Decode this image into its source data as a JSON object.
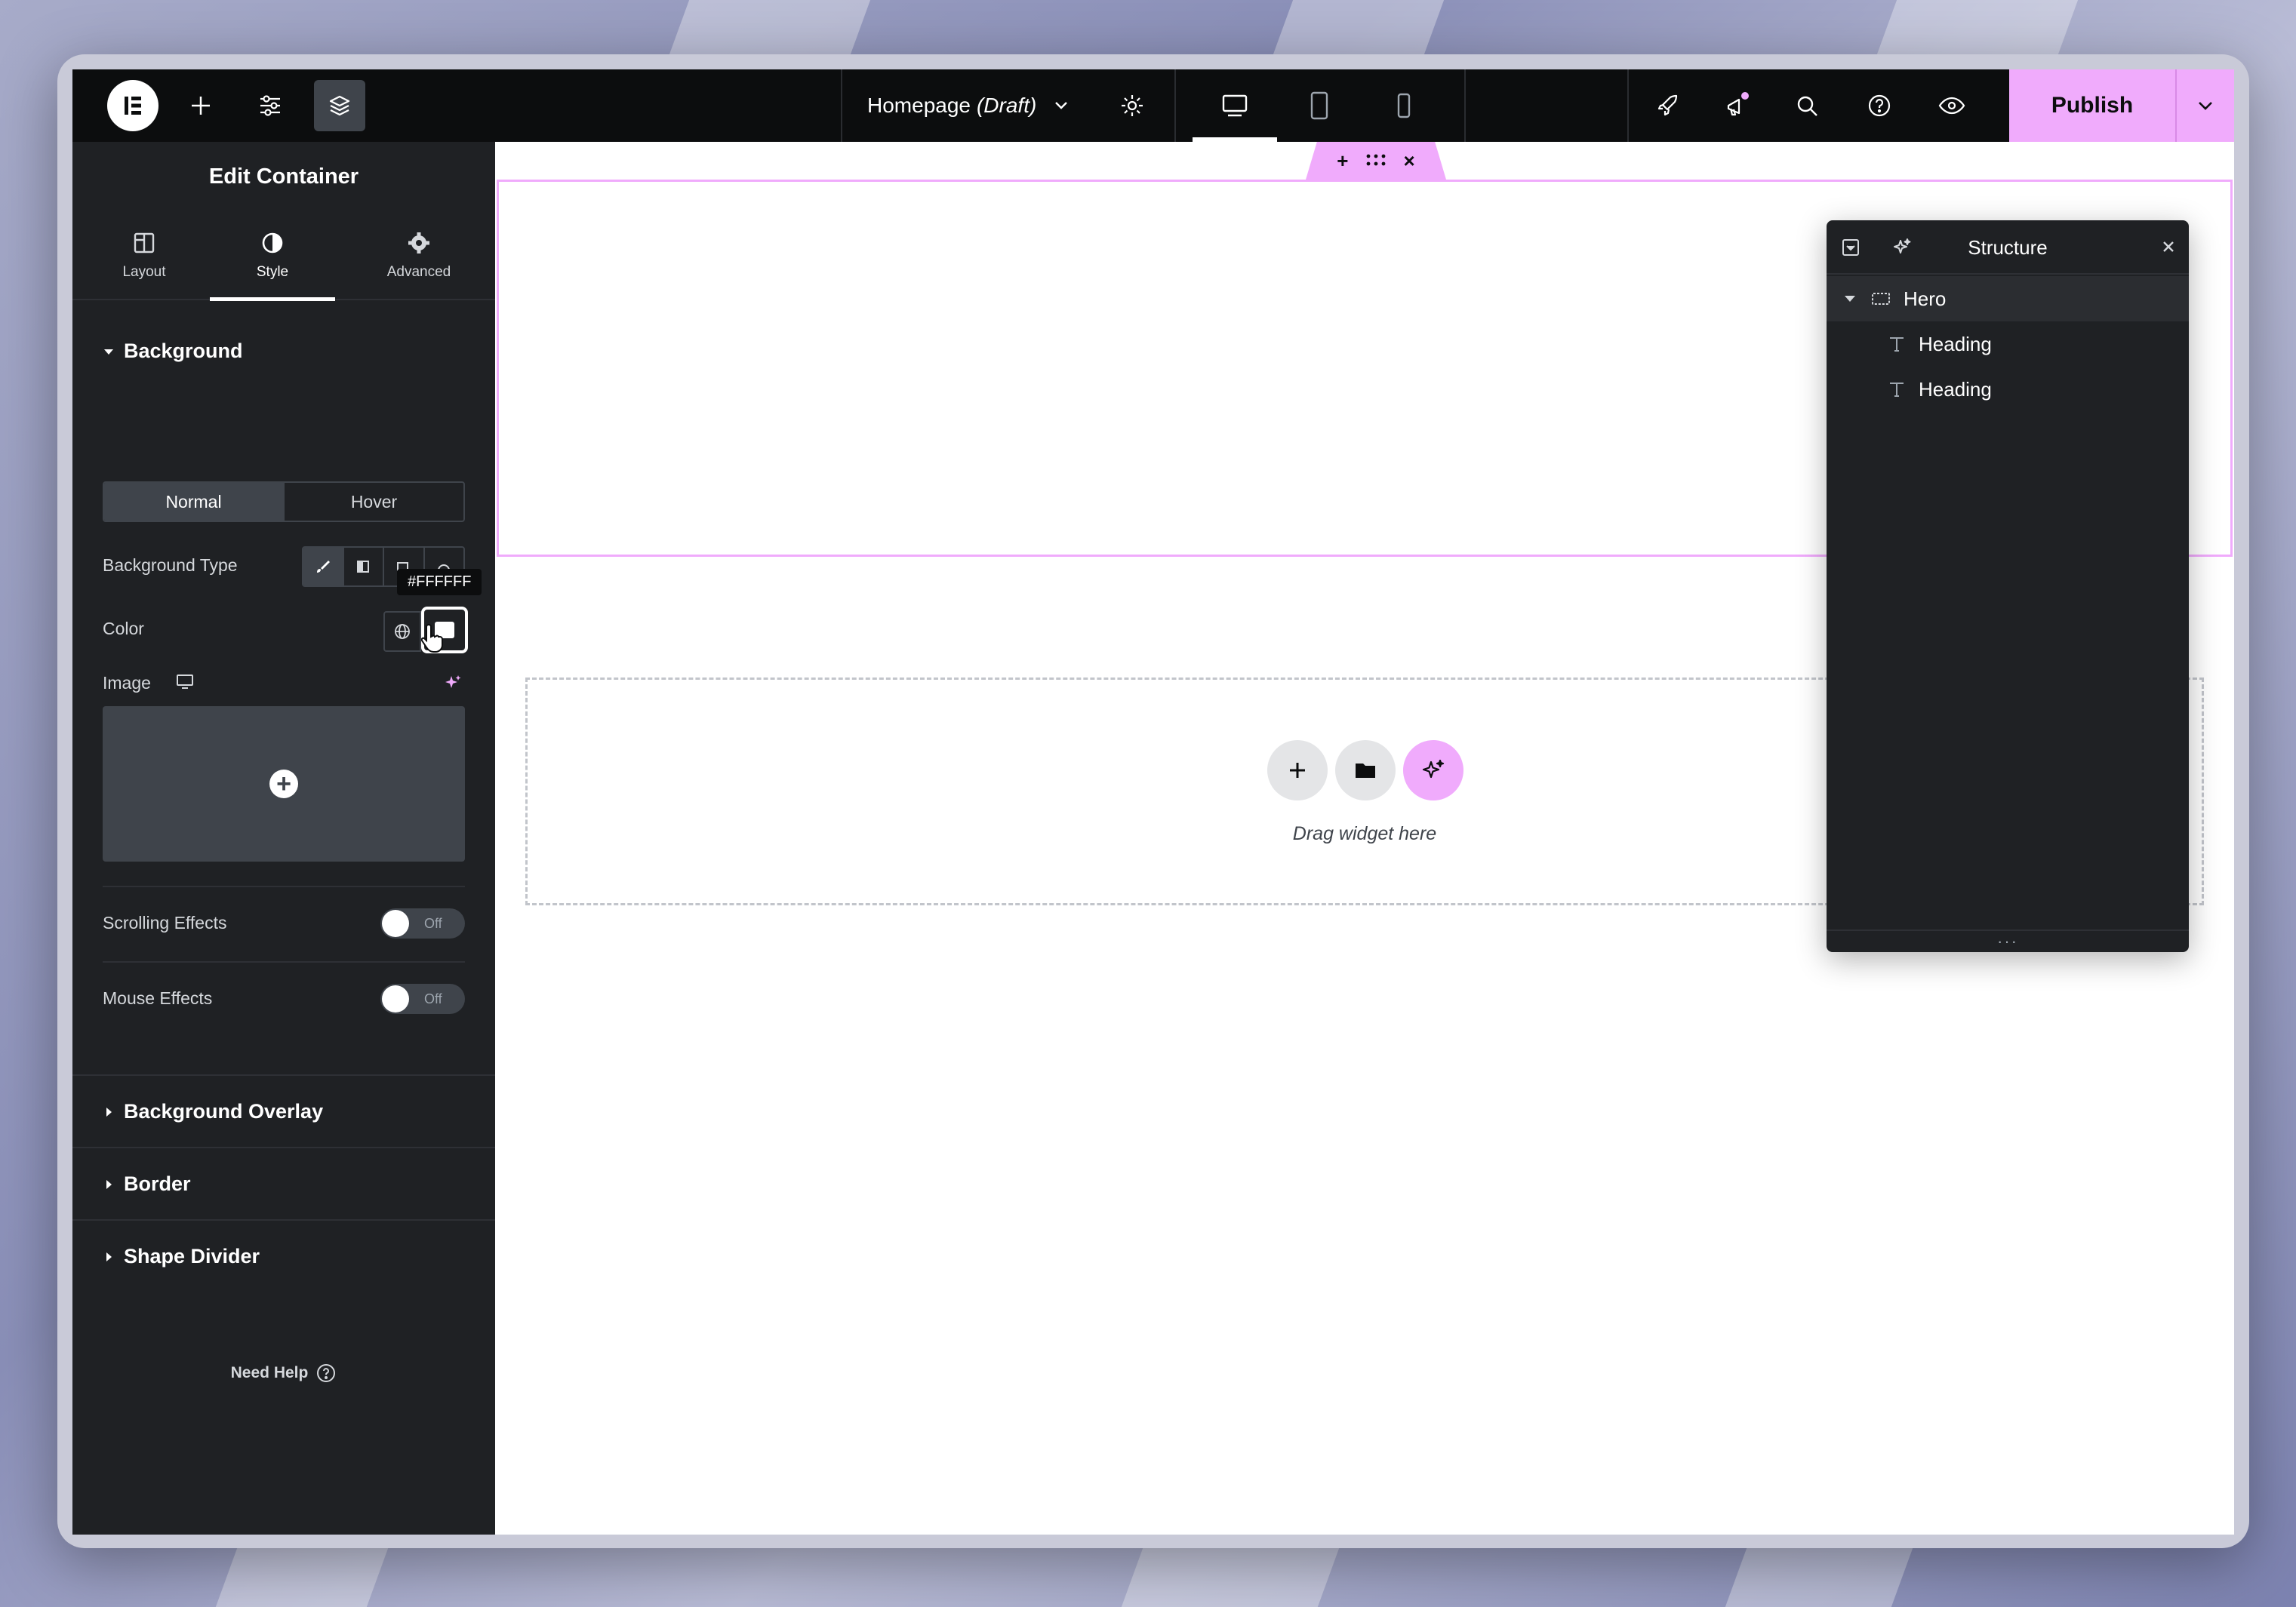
{
  "topbar": {
    "document_title": "Homepage",
    "document_status": "(Draft)",
    "publish_label": "Publish"
  },
  "panel": {
    "title": "Edit Container",
    "tabs": [
      {
        "label": "Layout"
      },
      {
        "label": "Style"
      },
      {
        "label": "Advanced"
      }
    ],
    "background": {
      "heading": "Background",
      "state_normal": "Normal",
      "state_hover": "Hover",
      "type_label": "Background Type",
      "color_label": "Color",
      "color_value": "#FFFFFF",
      "image_label": "Image"
    },
    "scrolling_effects": {
      "label": "Scrolling Effects",
      "state": "Off"
    },
    "mouse_effects": {
      "label": "Mouse Effects",
      "state": "Off"
    },
    "sections": [
      {
        "label": "Background Overlay"
      },
      {
        "label": "Border"
      },
      {
        "label": "Shape Divider"
      }
    ],
    "need_help": "Need Help"
  },
  "canvas": {
    "drag_text": "Drag widget here"
  },
  "structure": {
    "title": "Structure",
    "items": [
      {
        "label": "Hero"
      },
      {
        "label": "Heading"
      },
      {
        "label": "Heading"
      }
    ]
  },
  "colors": {
    "accent": "#f0abfc",
    "panel_bg": "#1f2124",
    "topbar_bg": "#0c0d0e"
  }
}
